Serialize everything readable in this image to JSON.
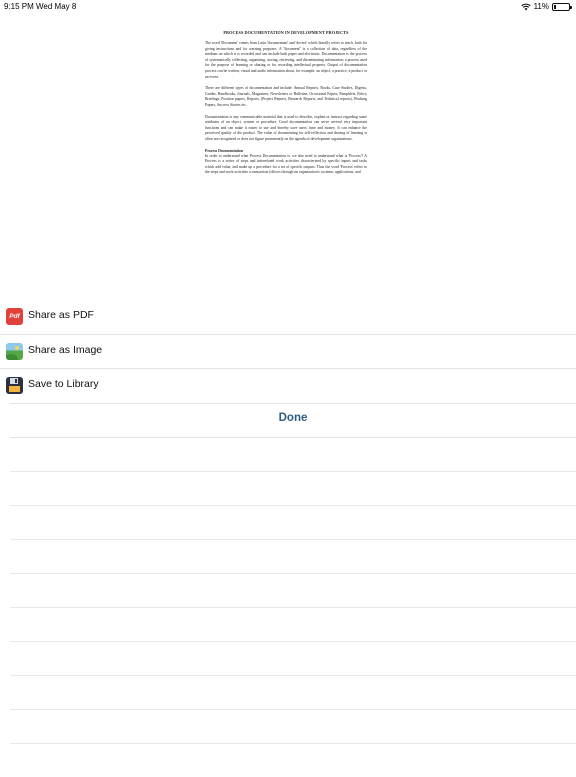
{
  "status_bar": {
    "time": "9:15 PM",
    "date": "Wed May 8",
    "battery": "11%"
  },
  "document": {
    "title": "PROCESS DOCUMENTATION IN DEVELOPMENT PROJECTS",
    "paragraphs": [
      "The word 'Document' comes from Latin 'documentum' and 'docere' which literally refers to teach, both for giving instructions and for warning purposes. A \"document\" is a collection of data, regardless of the medium on which it is recorded and can include both paper and electronic. Documentation is the process of systematically collecting, organizing, storing, retrieving, and disseminating information; a process used for the purpose of learning or sharing or for recording intellectual property. Output of documentation process can be written, visual and audio information about, for example, an object, a practice, a product or an event.",
      "There are different types of documentation and include: Annual Reports, Books, Case Studies, Digests, Guides, Handbooks, Journals, Magazines, Newsletters or Bulletins, Occasional Papers, Pamphlets, Policy Briefings, Position papers, Reports, (Project Reports, Research Reports, and Technical reports), Working Papers, Success Stories etc.",
      "Documentation is any communicable material that is used to describe, explain or instruct regarding some attributes of an object, system or procedure. Good documentation can serve several very important functions and can make it easier to use and thereby save users' time and money. It can enhance the perceived quality of the product. The value of documenting for self-reflection and sharing of learning is often not recognized or does not figure prominently on the agenda of development organizations."
    ],
    "heading": "Process Documentation",
    "last_paragraph": "In order to understand what Process Documentation is, we also need to understand what is 'Process'? A Process is a series of steps and interrelated work activities characterized by specific inputs and tasks which add value, and make up a procedure for a set of specific outputs. Thus the word 'Process' refers to the steps and work activities a transaction follows through an organization's systems; applications, and"
  },
  "menu": {
    "share_pdf": "Share as PDF",
    "pdf_icon_text": "Pdf",
    "share_image": "Share as Image",
    "save_library": "Save to Library",
    "done": "Done"
  },
  "colors": {
    "accent": "#2d5f86",
    "pdf_red": "#e2413a",
    "divider": "#e4e4e4"
  }
}
